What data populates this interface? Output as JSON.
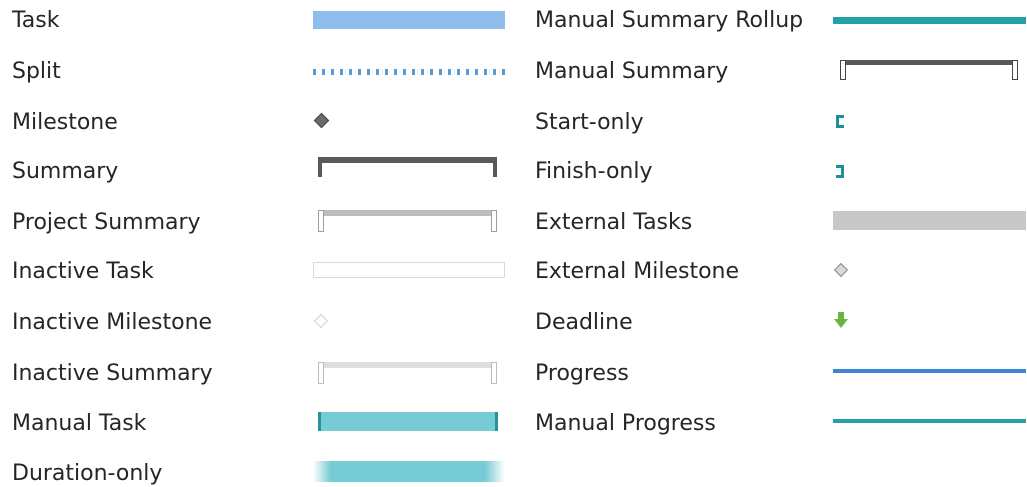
{
  "legend": {
    "left": [
      {
        "label": "Task"
      },
      {
        "label": "Split"
      },
      {
        "label": "Milestone"
      },
      {
        "label": "Summary"
      },
      {
        "label": "Project Summary"
      },
      {
        "label": "Inactive Task"
      },
      {
        "label": "Inactive Milestone"
      },
      {
        "label": "Inactive Summary"
      },
      {
        "label": "Manual Task"
      },
      {
        "label": "Duration-only"
      }
    ],
    "right": [
      {
        "label": "Manual Summary Rollup"
      },
      {
        "label": "Manual Summary"
      },
      {
        "label": "Start-only"
      },
      {
        "label": "Finish-only"
      },
      {
        "label": "External Tasks"
      },
      {
        "label": "External Milestone"
      },
      {
        "label": "Deadline"
      },
      {
        "label": "Progress"
      },
      {
        "label": "Manual Progress"
      }
    ]
  },
  "colors": {
    "task": "#8fbdee",
    "summary": "#595959",
    "manual_task": "#77cbd4",
    "manual_accent": "#23939e",
    "external": "#c8c8c8",
    "deadline": "#6db33f",
    "progress": "#3d86d6"
  }
}
